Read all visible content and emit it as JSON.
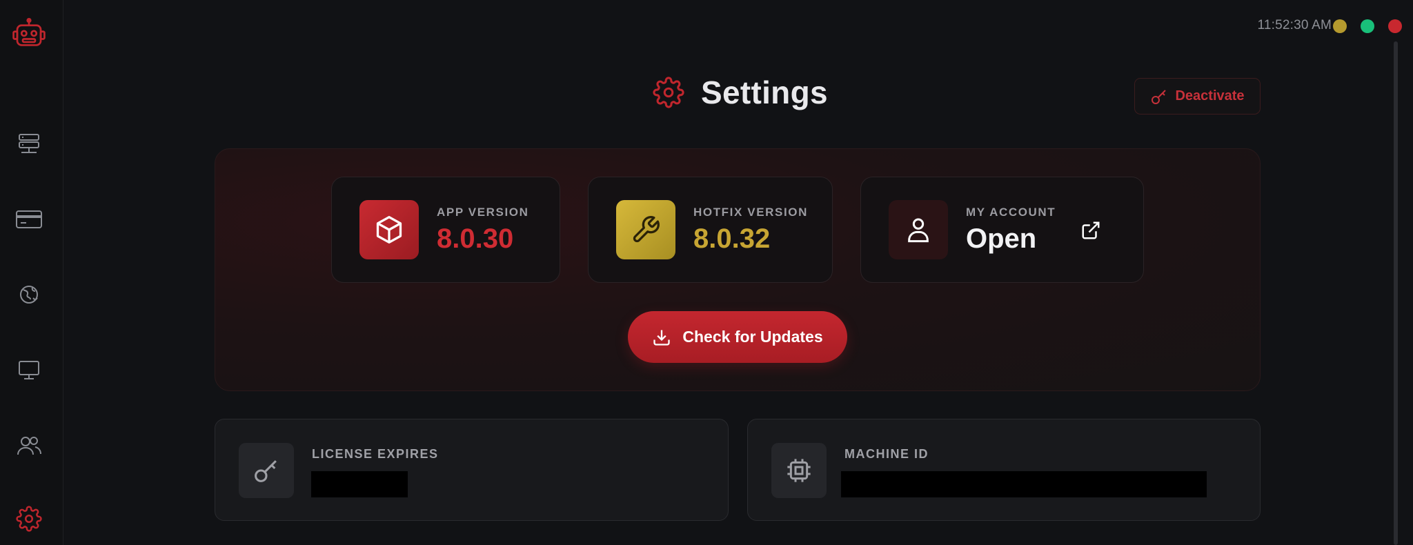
{
  "window": {
    "clock": "11:52:30 AM",
    "controls": [
      "minimize",
      "maximize",
      "close"
    ],
    "colors": {
      "minimize": "#b59a2e",
      "maximize": "#19c07a",
      "close": "#c8282f"
    }
  },
  "sidebar": {
    "logo_icon": "robot-icon",
    "items": [
      {
        "name": "servers",
        "icon": "server-stack-icon"
      },
      {
        "name": "billing",
        "icon": "credit-card-icon"
      },
      {
        "name": "proxies",
        "icon": "globe-refresh-icon"
      },
      {
        "name": "desktop",
        "icon": "monitor-icon"
      },
      {
        "name": "users",
        "icon": "users-icon"
      },
      {
        "name": "settings",
        "icon": "gear-icon",
        "active": true
      }
    ]
  },
  "header": {
    "title": "Settings",
    "title_icon": "gear-icon",
    "deactivate_label": "Deactivate"
  },
  "versions": {
    "app": {
      "label": "APP VERSION",
      "value": "8.0.30",
      "icon": "cube-icon"
    },
    "hotfix": {
      "label": "HOTFIX VERSION",
      "value": "8.0.32",
      "icon": "wrench-icon"
    },
    "account": {
      "label": "MY ACCOUNT",
      "value": "Open",
      "icon": "user-icon",
      "link_icon": "external-link-icon"
    }
  },
  "update_button": {
    "label": "Check for Updates",
    "icon": "download-icon"
  },
  "license": {
    "label": "LICENSE EXPIRES",
    "icon": "key-icon",
    "value_redacted": true
  },
  "machine": {
    "label": "MACHINE ID",
    "icon": "cpu-chip-icon",
    "value_redacted": true
  },
  "theme": {
    "accent": "#c0262d",
    "gold": "#c7a533",
    "background": "#111215"
  }
}
